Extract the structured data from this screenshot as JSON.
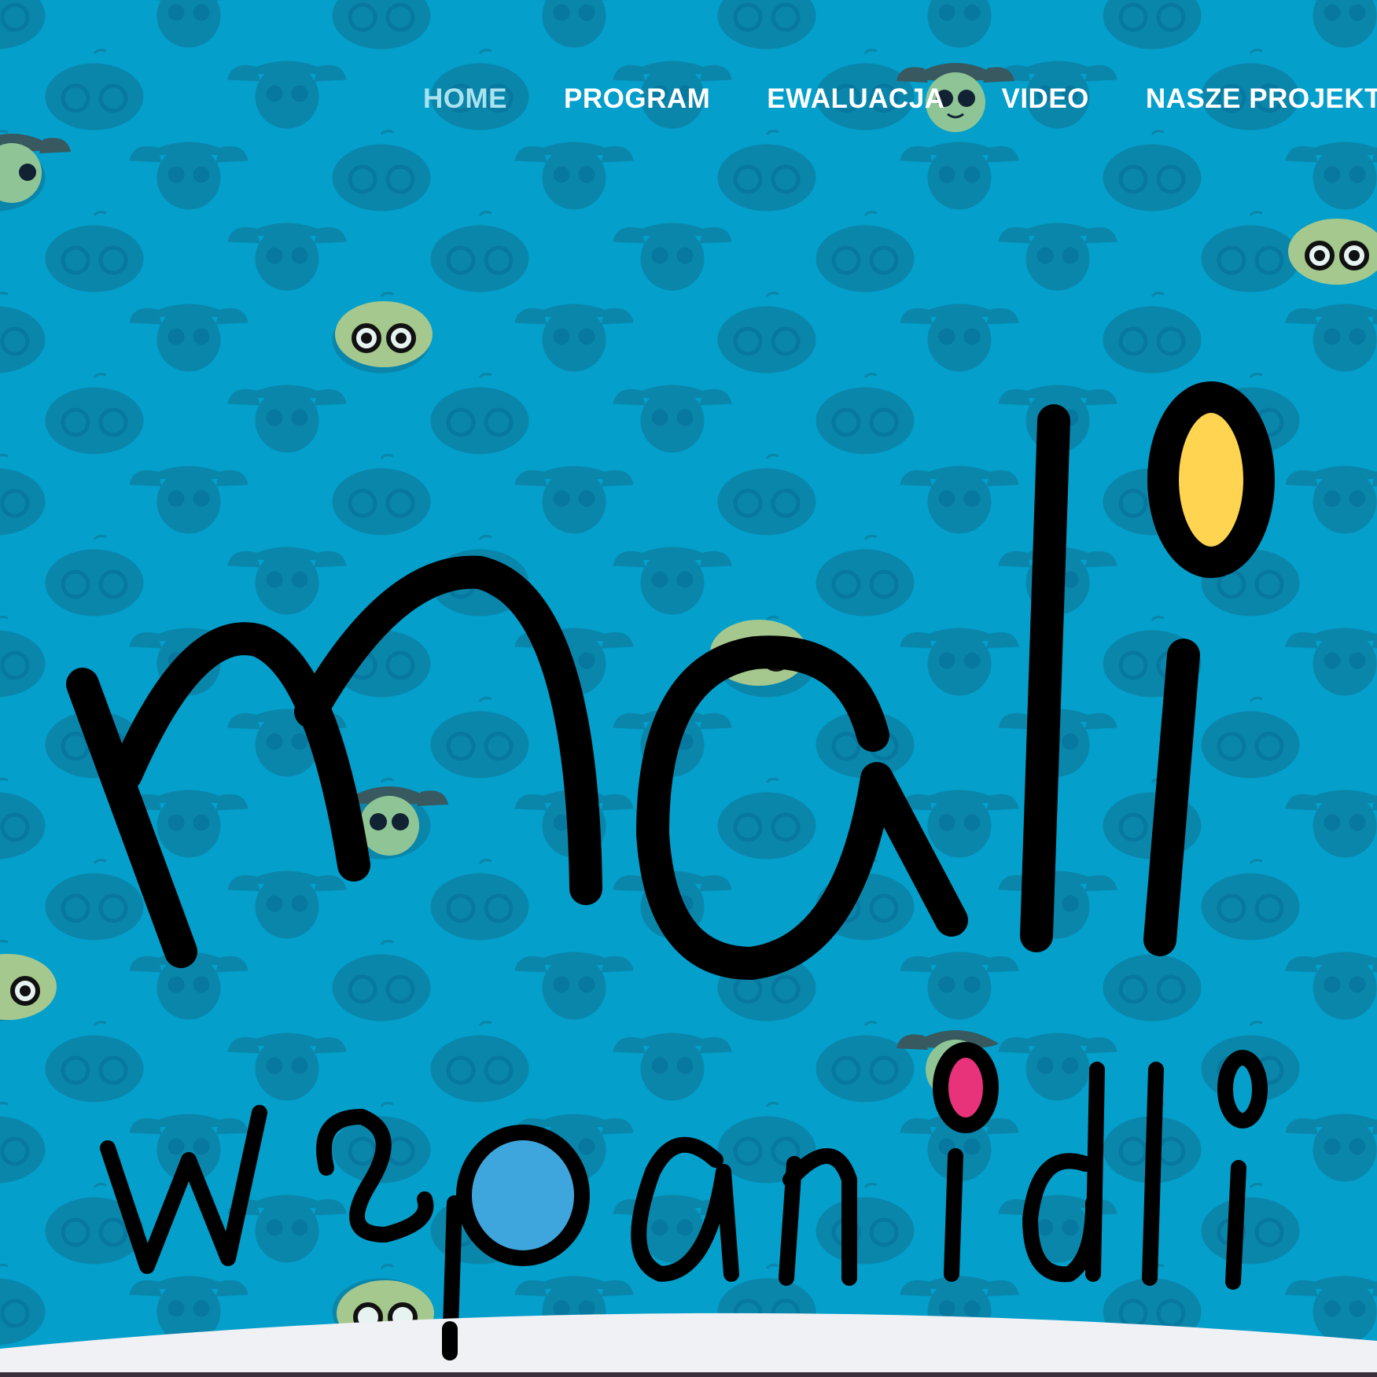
{
  "nav": {
    "items": [
      {
        "label": "HOME",
        "active": true
      },
      {
        "label": "PROGRAM",
        "active": false
      },
      {
        "label": "EWALUACJA",
        "active": false
      },
      {
        "label": "VIDEO",
        "active": false
      },
      {
        "label": "NASZE PROJEKTY",
        "active": false
      }
    ]
  },
  "logo": {
    "line1": "mali",
    "line2": "wspaniali",
    "dot_colors": {
      "yellow": "#ffd451",
      "pink": "#e8327a",
      "blue": "#3fa6dd"
    }
  },
  "colors": {
    "background": "#049fcb",
    "pattern_face": "#0a86ab",
    "nav_text": "#ffffff",
    "nav_active": "#a9e2ef",
    "logo_stroke": "#000000",
    "bottom_wave": "#f0f1f4"
  },
  "icons": [
    "girl-face-icon",
    "boy-glasses-face-icon"
  ]
}
